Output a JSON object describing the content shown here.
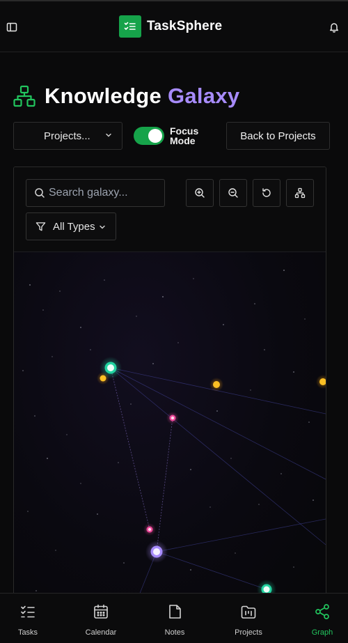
{
  "app": {
    "name": "TaskSphere"
  },
  "page": {
    "title_main": "Knowledge",
    "title_accent": "Galaxy"
  },
  "controls": {
    "project_select": "Projects...",
    "focus_label": "Focus Mode",
    "focus_on": true,
    "back_button": "Back to Projects"
  },
  "toolbar": {
    "search_placeholder": "Search galaxy...",
    "filter_label": "All Types",
    "tools": [
      "zoom-in-icon",
      "zoom-out-icon",
      "reset-icon",
      "hierarchy-icon"
    ]
  },
  "graph": {
    "colors": {
      "task": "#22d3a0",
      "project": "#a78bfa",
      "note": "#f59e0b",
      "tag": "#ec4899"
    }
  },
  "nav": {
    "items": [
      {
        "label": "Tasks",
        "icon": "tasks-icon",
        "active": false
      },
      {
        "label": "Calendar",
        "icon": "calendar-icon",
        "active": false
      },
      {
        "label": "Notes",
        "icon": "note-icon",
        "active": false
      },
      {
        "label": "Projects",
        "icon": "projects-icon",
        "active": false
      },
      {
        "label": "Graph",
        "icon": "graph-share-icon",
        "active": true
      }
    ]
  },
  "theme": {
    "accent": "#16a34a",
    "accent_text": "#22c55e",
    "purple": "#a78bfa",
    "bg": "#0a0a0b"
  }
}
